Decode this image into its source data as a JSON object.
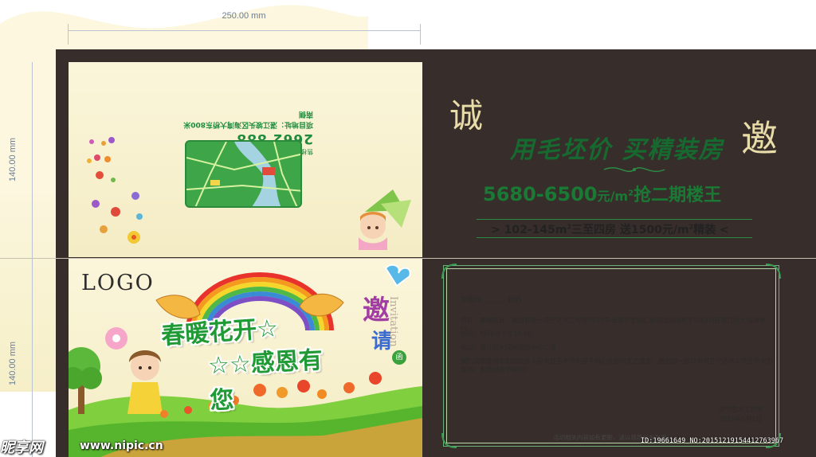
{
  "dimensions": {
    "width_label": "250.00 mm",
    "height_top_label": "140.00 mm",
    "height_bottom_label": "140.00 mm"
  },
  "contact": {
    "tel_label": "售楼热线",
    "tel_code": "0759",
    "tel_number": "2662 888",
    "address": "项目地址：湛江坡头区海湾大桥东800米南侧"
  },
  "cover": {
    "logo": "LOGO",
    "slogan_line1": "春暖花开☆",
    "slogan_line2": "☆☆感恩有您",
    "invite_char1": "邀",
    "invite_char2": "请",
    "invite_en": "Invitation",
    "invite_badge": "函"
  },
  "promo": {
    "calli_left": "诚",
    "calli_right": "邀",
    "headline": "用毛坯价 买精装房",
    "price_range": "5680-6500",
    "price_unit": "元/m",
    "price_sup": "2",
    "price_tail": "抢二期楼王",
    "sub_prefix": "> 102-145m",
    "sub_sup1": "2",
    "sub_mid": "三至四房 送1500元/m",
    "sub_sup2": "2",
    "sub_tail": "精装 <"
  },
  "letter": {
    "greeting": "尊敬的＿＿＿＿妈妈：",
    "para1": "您好！春暖花开，感恩有您一芷宁艺术工作室2015年母亲节专场汇报演出活动将于5月9日在湛江恒大绿洲举行",
    "time": "时间：5月9日下午14:00",
    "place": "地点：湛江恒大绿洲销售中心二楼",
    "para2": "我们诚挚邀请您和您的家人前来观看老师和孩子精心准备的文艺盛宴，感谢您一直以来对芷宁艺术工作室的大力支持，祝您母亲节快乐！",
    "sign_name": "芷宁艺术工作室",
    "sign_date": "2015年5月1日",
    "note": "活动相关内容如有更新，请以现场公布为准"
  },
  "watermark": {
    "brand": "昵享网",
    "url": "www.nipic.cn",
    "id_line": "ID:19661649 NO:20151219154412763967"
  },
  "colors": {
    "frame": "#372d2a",
    "paper": "#fbf6db",
    "green": "#1a7a35",
    "rainbow_red": "#e8322b"
  }
}
